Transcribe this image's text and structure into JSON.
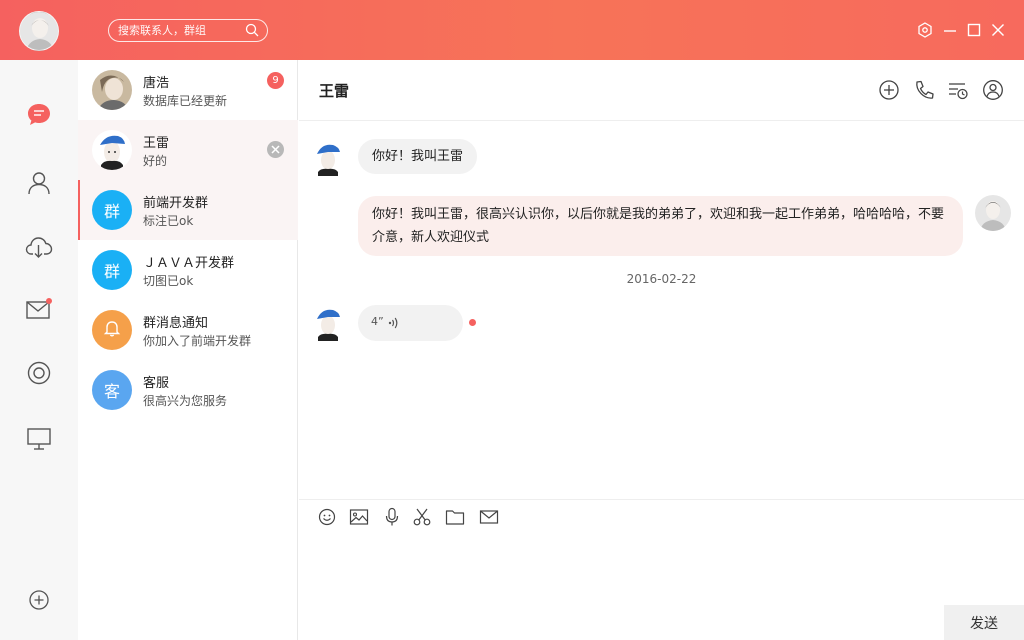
{
  "search": {
    "placeholder": "搜索联系人，群组"
  },
  "contacts": [
    {
      "name": "唐浩",
      "message": "数据库已经更新",
      "badge": "9"
    },
    {
      "name": "王雷",
      "message": "好的"
    },
    {
      "name": "前端开发群",
      "message": "标注已ok",
      "avatar_text": "群",
      "avatar_color": "#1ab0f5"
    },
    {
      "name": "ＪＡＶＡ开发群",
      "message": "切图已ok",
      "avatar_text": "群",
      "avatar_color": "#1ab0f5"
    },
    {
      "name": "群消息通知",
      "message": "你加入了前端开发群",
      "avatar_color": "#f5a04a"
    },
    {
      "name": "客服",
      "message": "很高兴为您服务",
      "avatar_text": "客",
      "avatar_color": "#5aa6f0"
    }
  ],
  "chat": {
    "title": "王雷",
    "messages": [
      {
        "direction": "in",
        "text": "你好！我叫王雷"
      },
      {
        "direction": "out",
        "text": "你好！我叫王雷，很高兴认识你，以后你就是我的弟弟了，欢迎和我一起工作弟弟，哈哈哈哈，不要介意，新人欢迎仪式"
      }
    ],
    "date": "2016-02-22",
    "voice": {
      "duration": "4”"
    }
  },
  "composer": {
    "send_label": "发送"
  },
  "colors": {
    "accent": "#f5615f",
    "group_blue": "#1ab0f5",
    "notice_orange": "#f5a04a"
  }
}
